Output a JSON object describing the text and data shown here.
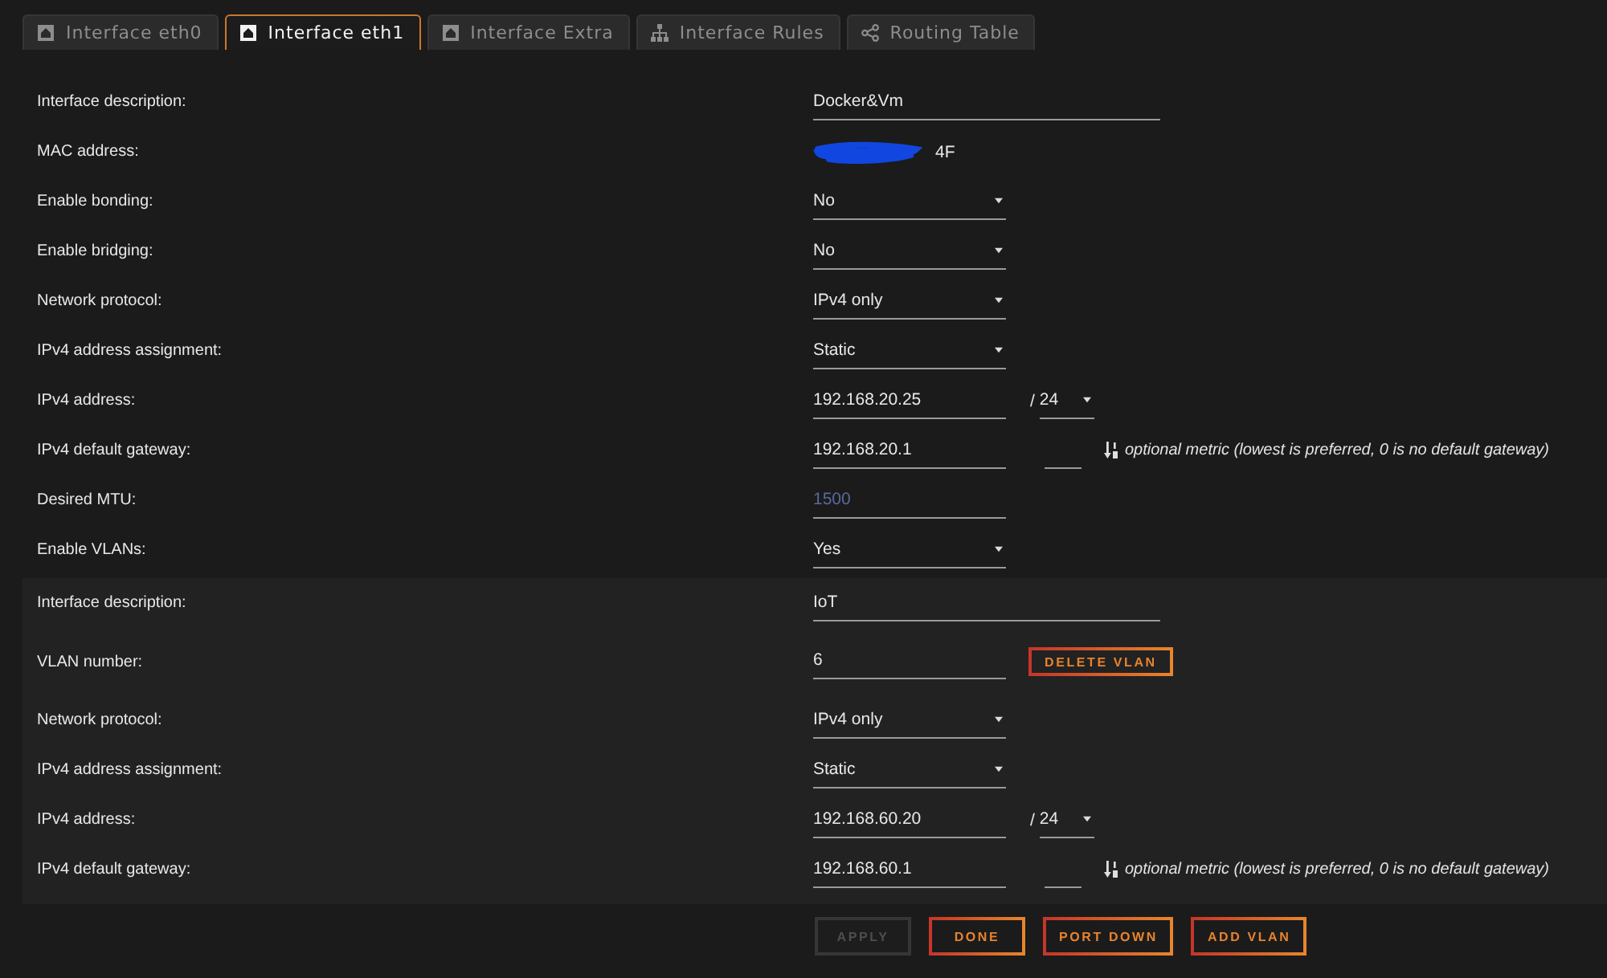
{
  "tabs": [
    {
      "label": "Interface eth0",
      "kind": "interface",
      "selected": false
    },
    {
      "label": "Interface eth1",
      "kind": "interface",
      "selected": true
    },
    {
      "label": "Interface Extra",
      "kind": "interface",
      "selected": false
    },
    {
      "label": "Interface Rules",
      "kind": "rules",
      "selected": false
    },
    {
      "label": "Routing Table",
      "kind": "routing",
      "selected": false
    }
  ],
  "sections": [
    {
      "kind": "interface",
      "rows": [
        {
          "label": "Interface description:",
          "kind": "long_text",
          "value": "Docker&Vm"
        },
        {
          "label": "MAC address:",
          "kind": "static",
          "value": "4F",
          "redacted": true
        },
        {
          "label": "Enable bonding:",
          "kind": "select",
          "value": "No"
        },
        {
          "label": "Enable bridging:",
          "kind": "select",
          "value": "No"
        },
        {
          "label": "Network protocol:",
          "kind": "select",
          "value": "IPv4 only"
        },
        {
          "label": "IPv4 address assignment:",
          "kind": "select",
          "value": "Static"
        },
        {
          "label": "IPv4 address:",
          "kind": "address",
          "value": "192.168.20.25",
          "separator": "/",
          "prefix": "24"
        },
        {
          "label": "IPv4 default gateway:",
          "kind": "gateway",
          "value": "192.168.20.1",
          "hint": "optional metric (lowest is preferred, 0 is no default gateway)"
        },
        {
          "label": "Desired MTU:",
          "kind": "text",
          "placeholder": "1500"
        },
        {
          "label": "Enable VLANs:",
          "kind": "select",
          "value": "Yes"
        }
      ]
    },
    {
      "kind": "vlan",
      "rows": [
        {
          "label": "Interface description:",
          "kind": "long_text",
          "value": "IoT"
        },
        {
          "label": "VLAN number:",
          "kind": "text",
          "value": "6",
          "action": "DELETE VLAN"
        },
        {
          "label": "Network protocol:",
          "kind": "select",
          "value": "IPv4 only"
        },
        {
          "label": "IPv4 address assignment:",
          "kind": "select",
          "value": "Static"
        },
        {
          "label": "IPv4 address:",
          "kind": "address",
          "value": "192.168.60.20",
          "separator": "/",
          "prefix": "24"
        },
        {
          "label": "IPv4 default gateway:",
          "kind": "gateway",
          "value": "192.168.60.1",
          "hint": "optional metric (lowest is preferred, 0 is no default gateway)"
        }
      ]
    }
  ],
  "buttons": [
    {
      "label": "APPLY",
      "disabled": true
    },
    {
      "label": "DONE",
      "disabled": false
    },
    {
      "label": "PORT DOWN",
      "disabled": false
    },
    {
      "label": "ADD VLAN",
      "disabled": false
    }
  ]
}
